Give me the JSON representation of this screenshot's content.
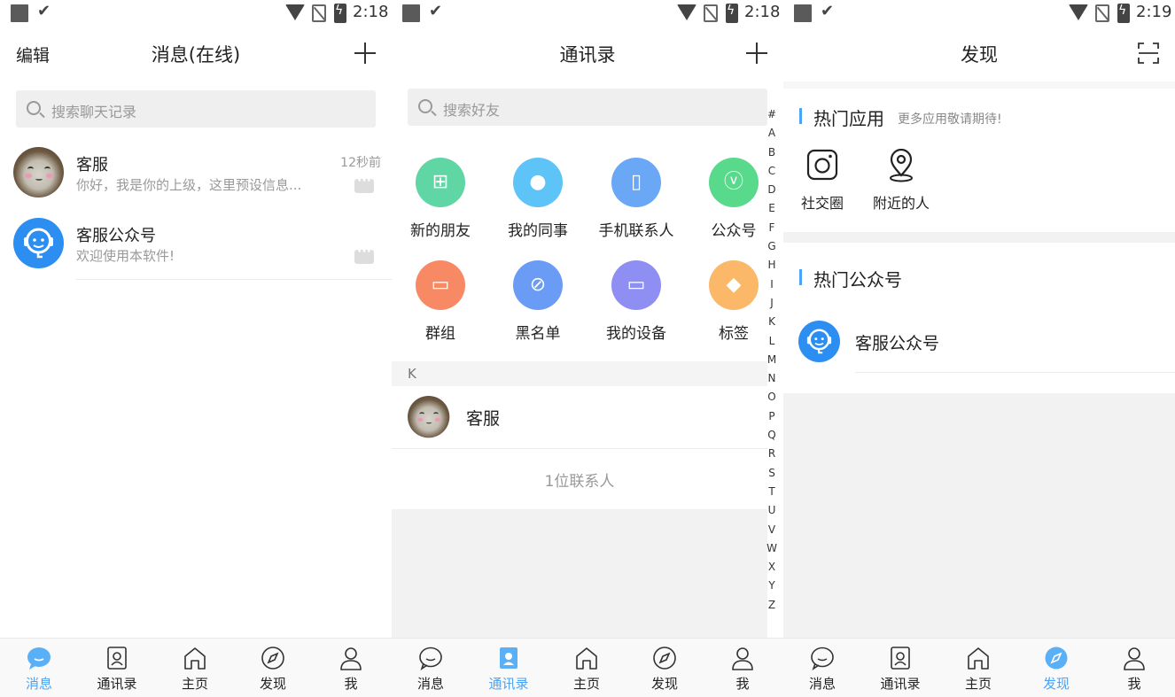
{
  "status": {
    "times": [
      "2:18",
      "2:18",
      "2:19"
    ]
  },
  "messages": {
    "header": {
      "edit": "编辑",
      "title": "消息(在线)"
    },
    "search_placeholder": "搜索聊天记录",
    "chats": [
      {
        "name": "客服",
        "message": "你好，我是你的上级，这里预设信息...",
        "time": "12秒前"
      },
      {
        "name": "客服公众号",
        "message": "欢迎使用本软件!",
        "time": ""
      }
    ]
  },
  "contacts": {
    "header": {
      "title": "通讯录"
    },
    "search_placeholder": "搜索好友",
    "grid": [
      {
        "label": "新的朋友",
        "icon": "add-friend-icon",
        "color": "#5fd6a3"
      },
      {
        "label": "我的同事",
        "icon": "colleague-icon",
        "color": "#5ec4f7"
      },
      {
        "label": "手机联系人",
        "icon": "phone-contacts-icon",
        "color": "#6aa8f5"
      },
      {
        "label": "公众号",
        "icon": "official-account-icon",
        "color": "#59d98c"
      },
      {
        "label": "群组",
        "icon": "group-icon",
        "color": "#f78a64"
      },
      {
        "label": "黑名单",
        "icon": "blacklist-icon",
        "color": "#6a9cf5"
      },
      {
        "label": "我的设备",
        "icon": "device-icon",
        "color": "#8f8ff3"
      },
      {
        "label": "标签",
        "icon": "tag-icon",
        "color": "#fbb868"
      }
    ],
    "section": "K",
    "contact": {
      "name": "客服"
    },
    "count": "1位联系人",
    "alphabet": [
      "#",
      "A",
      "B",
      "C",
      "D",
      "E",
      "F",
      "G",
      "H",
      "I",
      "J",
      "K",
      "L",
      "M",
      "N",
      "O",
      "P",
      "Q",
      "R",
      "S",
      "T",
      "U",
      "V",
      "W",
      "X",
      "Y",
      "Z"
    ]
  },
  "discover": {
    "header": {
      "title": "发现"
    },
    "hot_apps": {
      "title": "热门应用",
      "subtitle": "更多应用敬请期待!"
    },
    "apps": [
      {
        "label": "社交圈",
        "icon": "camera-icon"
      },
      {
        "label": "附近的人",
        "icon": "location-icon"
      }
    ],
    "hot_accounts": {
      "title": "热门公众号"
    },
    "account": {
      "name": "客服公众号"
    }
  },
  "tabs": [
    {
      "label": "消息",
      "icon": "chat-icon"
    },
    {
      "label": "通讯录",
      "icon": "contacts-icon"
    },
    {
      "label": "主页",
      "icon": "home-icon"
    },
    {
      "label": "发现",
      "icon": "compass-icon"
    },
    {
      "label": "我",
      "icon": "person-icon"
    }
  ],
  "colors": {
    "accent": "#4aa3f5",
    "cs_blue": "#2b8ef0"
  }
}
